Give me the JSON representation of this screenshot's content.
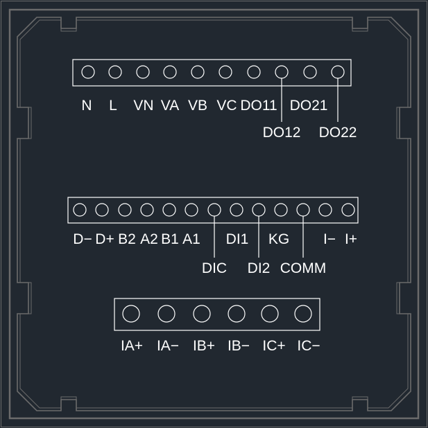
{
  "colors": {
    "background": "#212830",
    "frame": "#6b6b6b",
    "lines": "#ffffff"
  },
  "terminal_strip_top": {
    "labels": [
      "N",
      "L",
      "VN",
      "VA",
      "VB",
      "VC",
      "DO11",
      "DO21"
    ],
    "lower_labels": [
      "DO12",
      "DO22"
    ]
  },
  "terminal_strip_middle": {
    "labels": [
      "D−",
      "D+",
      "B2",
      "A2",
      "B1",
      "A1",
      "DI1",
      "KG",
      "I−",
      "I+"
    ],
    "lower_labels": [
      "DIC",
      "DI2",
      "COMM"
    ]
  },
  "terminal_strip_bottom": {
    "labels": [
      "IA+",
      "IA−",
      "IB+",
      "IB−",
      "IC+",
      "IC−"
    ]
  }
}
